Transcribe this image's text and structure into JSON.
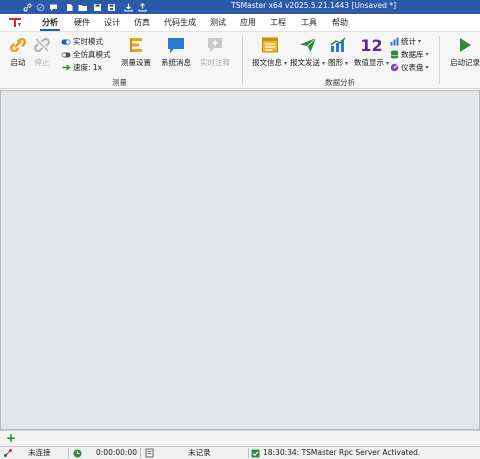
{
  "window": {
    "title": "TSMaster x64 v2025.5.21.1443 [Unsaved *]"
  },
  "menu": {
    "tabs": [
      "分析",
      "硬件",
      "设计",
      "仿真",
      "代码生成",
      "测试",
      "应用",
      "工程",
      "工具",
      "帮助"
    ],
    "active_tab": "分析"
  },
  "ribbon": {
    "start": "启动",
    "stop": "停止",
    "realtime_mode": "实时模式",
    "full_sim_mode": "全仿真模式",
    "speed": "速度: 1x",
    "measure_setup": "测量设置",
    "system_msg": "系统消息",
    "realtime_comment": "实时注释",
    "group_measure": "测量",
    "msg_info": "报文信息",
    "msg_send": "报文发送",
    "graphics": "图形",
    "value_display": "数值显示",
    "value_display_icon_text": "12",
    "statistics": "统计",
    "database": "数据库",
    "dashboard": "仪表盘",
    "group_data_analysis": "数据分析",
    "start_record": "启动记录"
  },
  "status": {
    "connection": "未连接",
    "time": "0:00:00:00",
    "record": "未记录",
    "message": "18:30:34: TSMaster Rpc Server Activated."
  },
  "bottom_tabs": {
    "add_label": "+"
  }
}
